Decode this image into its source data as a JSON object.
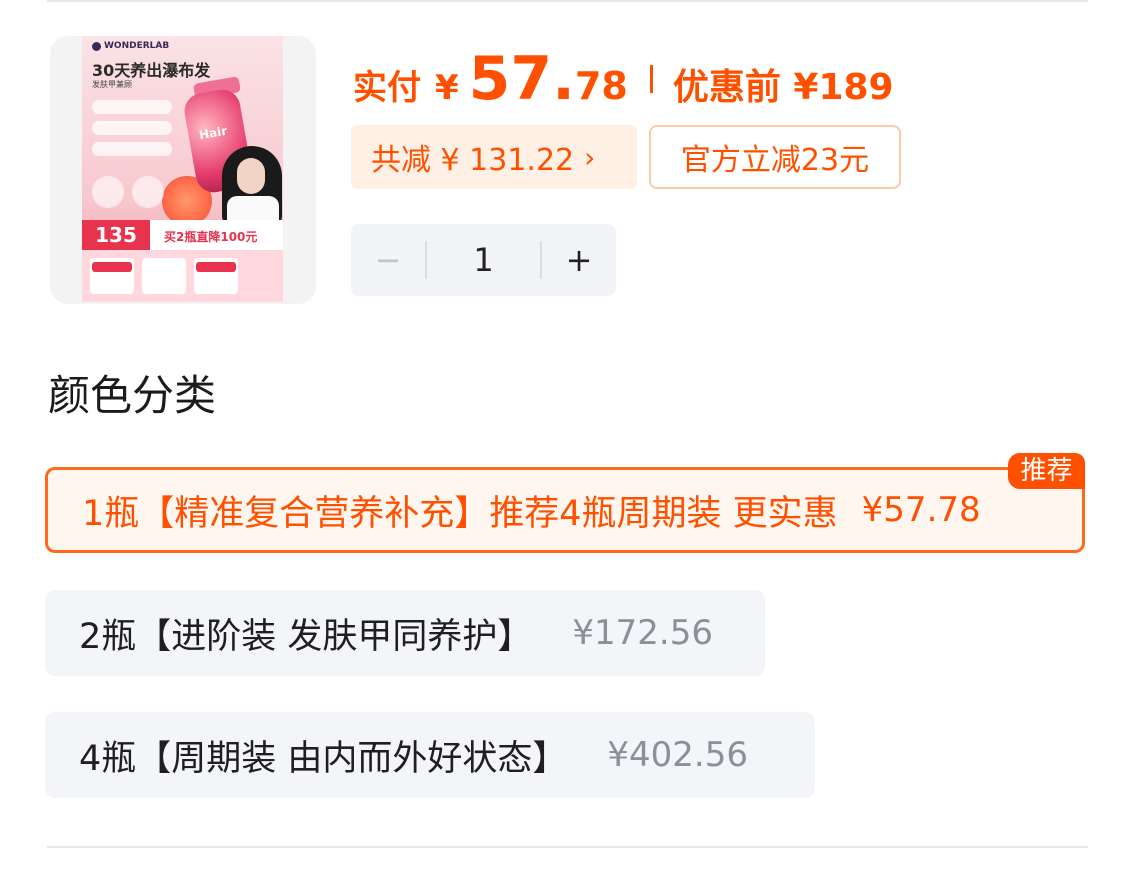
{
  "product": {
    "image_brand": "WONDERLAB",
    "image_headline": "30天养出瀑布发",
    "image_subhead": "发肤甲兼顾",
    "image_price": "135",
    "image_promo": "买2瓶直降100元",
    "image_jar_label": "Hair"
  },
  "price": {
    "paid_label": "实付",
    "currency": "¥",
    "integer": "57.",
    "decimal": "78",
    "original": "优惠前 ¥189"
  },
  "discounts": {
    "total": "共减 ¥ 131.22",
    "total_chevron": "›",
    "official": "官方立减23元"
  },
  "quantity": {
    "minus": "−",
    "value": "1",
    "plus": "+"
  },
  "section": {
    "title": "颜色分类"
  },
  "options": [
    {
      "label": "1瓶【精准复合营养补充】推荐4瓶周期装 更实惠",
      "price": "¥57.78",
      "tag": "推荐",
      "selected": true
    },
    {
      "label": "2瓶【进阶装 发肤甲同养护】",
      "price": "¥172.56",
      "selected": false
    },
    {
      "label": "4瓶【周期装 由内而外好状态】",
      "price": "¥402.56",
      "selected": false
    }
  ],
  "colors": {
    "accent": "#ff5000",
    "accent_light_bg": "#fff0e6",
    "option_bg": "#f3f5f8",
    "muted_price": "#8a8f98"
  }
}
